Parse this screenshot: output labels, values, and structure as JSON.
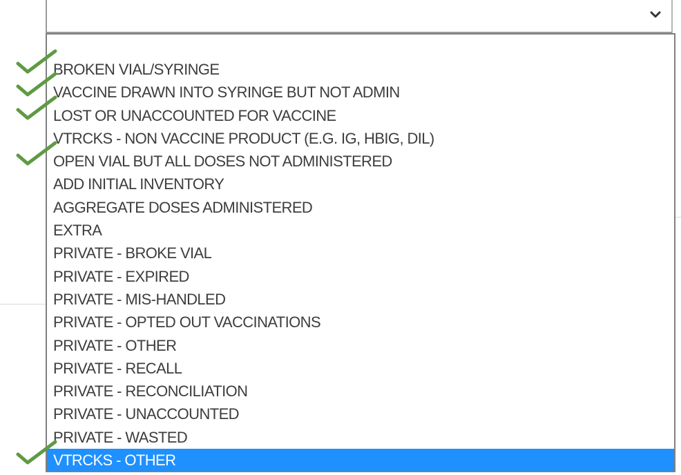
{
  "select": {
    "value": "",
    "chevron_icon": "chevron-down-icon"
  },
  "dropdown": {
    "options": [
      {
        "label": "BROKEN VIAL/SYRINGE",
        "checked": true
      },
      {
        "label": "VACCINE DRAWN INTO SYRINGE BUT NOT ADMIN",
        "checked": true
      },
      {
        "label": "LOST OR UNACCOUNTED FOR VACCINE",
        "checked": true
      },
      {
        "label": "VTRCKS - NON VACCINE PRODUCT (E.G. IG, HBIG, DIL)",
        "checked": false
      },
      {
        "label": "OPEN VIAL BUT ALL DOSES NOT ADMINISTERED",
        "checked": true
      },
      {
        "label": "ADD INITIAL INVENTORY",
        "checked": false
      },
      {
        "label": "AGGREGATE DOSES ADMINISTERED",
        "checked": false
      },
      {
        "label": "EXTRA",
        "checked": false
      },
      {
        "label": "PRIVATE - BROKE VIAL",
        "checked": false
      },
      {
        "label": "PRIVATE - EXPIRED",
        "checked": false
      },
      {
        "label": "PRIVATE - MIS-HANDLED",
        "checked": false
      },
      {
        "label": "PRIVATE - OPTED OUT VACCINATIONS",
        "checked": false
      },
      {
        "label": "PRIVATE - OTHER",
        "checked": false
      },
      {
        "label": "PRIVATE - RECALL",
        "checked": false
      },
      {
        "label": "PRIVATE - RECONCILIATION",
        "checked": false
      },
      {
        "label": "PRIVATE - UNACCOUNTED",
        "checked": false
      },
      {
        "label": "PRIVATE - WASTED",
        "checked": false
      },
      {
        "label": "VTRCKS - OTHER",
        "checked": true,
        "selected": true
      }
    ],
    "check_icon": "checkmark-icon"
  },
  "colors": {
    "selected_bg": "#1e90ff",
    "selected_text": "#ffffff",
    "option_text": "#3d3d3d",
    "check": "#5f9a43",
    "border": "#7f7f7f"
  }
}
